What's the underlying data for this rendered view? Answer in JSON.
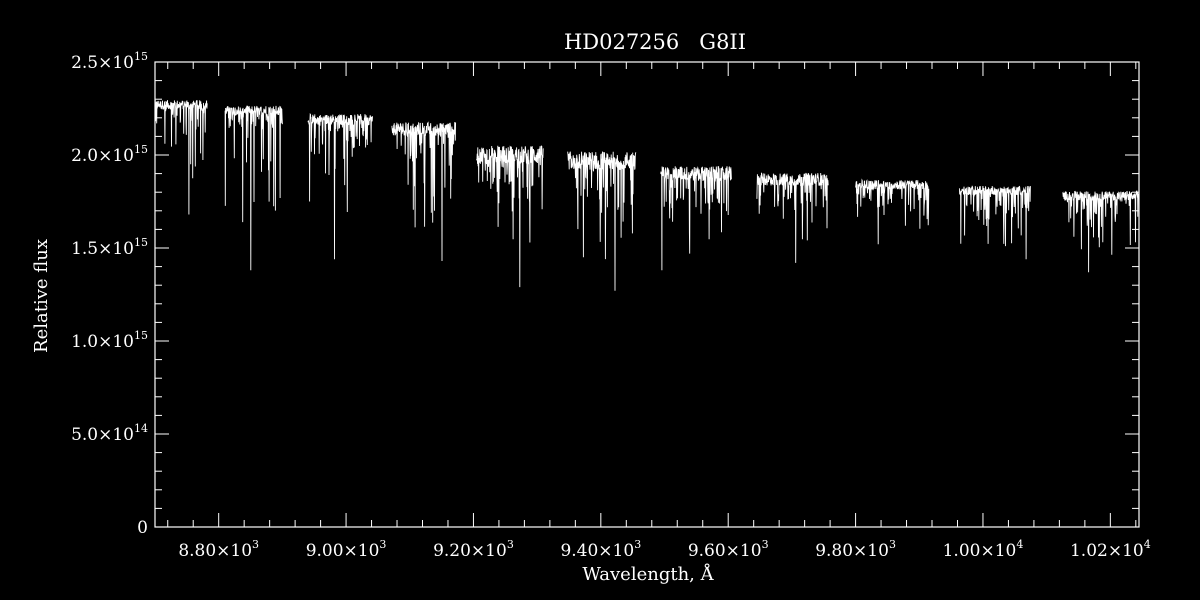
{
  "chart_data": {
    "type": "line",
    "title": "HD027256   G8II",
    "xlabel": "Wavelength, Å",
    "ylabel": "Relative flux",
    "xlim": [
      8700,
      10245
    ],
    "ylim": [
      0,
      2500000000000000.0
    ],
    "grid": false,
    "background": "#000000",
    "line_color": "#ffffff",
    "x_ticks": [
      {
        "value": 8800,
        "mantissa": "8.80",
        "exp": "3"
      },
      {
        "value": 9000,
        "mantissa": "9.00",
        "exp": "3"
      },
      {
        "value": 9200,
        "mantissa": "9.20",
        "exp": "3"
      },
      {
        "value": 9400,
        "mantissa": "9.40",
        "exp": "3"
      },
      {
        "value": 9600,
        "mantissa": "9.60",
        "exp": "3"
      },
      {
        "value": 9800,
        "mantissa": "9.80",
        "exp": "3"
      },
      {
        "value": 10000,
        "mantissa": "1.00",
        "exp": "4"
      },
      {
        "value": 10200,
        "mantissa": "1.02",
        "exp": "4"
      }
    ],
    "y_ticks": [
      {
        "value": 0,
        "mantissa": "0",
        "exp": ""
      },
      {
        "value": 500000000000000.0,
        "mantissa": "5.0",
        "exp": "14"
      },
      {
        "value": 1000000000000000.0,
        "mantissa": "1.0",
        "exp": "15"
      },
      {
        "value": 1500000000000000.0,
        "mantissa": "1.5",
        "exp": "15"
      },
      {
        "value": 2000000000000000.0,
        "mantissa": "2.0",
        "exp": "15"
      },
      {
        "value": 2500000000000000.0,
        "mantissa": "2.5",
        "exp": "15"
      }
    ],
    "segments": [
      {
        "x_start": 8700,
        "x_end": 8782,
        "continuum": 2270000000000000.0,
        "noise": 50000000000000.0,
        "deepest": 1680000000000000.0
      },
      {
        "x_start": 8810,
        "x_end": 8900,
        "continuum": 2240000000000000.0,
        "noise": 50000000000000.0,
        "deepest": 1380000000000000.0
      },
      {
        "x_start": 8940,
        "x_end": 9042,
        "continuum": 2190000000000000.0,
        "noise": 60000000000000.0,
        "deepest": 1440000000000000.0
      },
      {
        "x_start": 9072,
        "x_end": 9172,
        "continuum": 2140000000000000.0,
        "noise": 70000000000000.0,
        "deepest": 1430000000000000.0
      },
      {
        "x_start": 9205,
        "x_end": 9310,
        "continuum": 2000000000000000.0,
        "noise": 100000000000000.0,
        "deepest": 1290000000000000.0
      },
      {
        "x_start": 9348,
        "x_end": 9455,
        "continuum": 1970000000000000.0,
        "noise": 100000000000000.0,
        "deepest": 1270000000000000.0
      },
      {
        "x_start": 9494,
        "x_end": 9605,
        "continuum": 1900000000000000.0,
        "noise": 80000000000000.0,
        "deepest": 1380000000000000.0
      },
      {
        "x_start": 9645,
        "x_end": 9757,
        "continuum": 1870000000000000.0,
        "noise": 70000000000000.0,
        "deepest": 1420000000000000.0
      },
      {
        "x_start": 9800,
        "x_end": 9915,
        "continuum": 1840000000000000.0,
        "noise": 50000000000000.0,
        "deepest": 1520000000000000.0
      },
      {
        "x_start": 9963,
        "x_end": 10075,
        "continuum": 1810000000000000.0,
        "noise": 50000000000000.0,
        "deepest": 1440000000000000.0
      },
      {
        "x_start": 10125,
        "x_end": 10245,
        "continuum": 1780000000000000.0,
        "noise": 50000000000000.0,
        "deepest": 1370000000000000.0
      }
    ]
  }
}
